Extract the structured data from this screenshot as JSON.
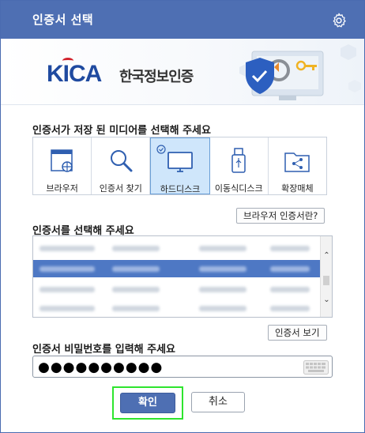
{
  "window": {
    "title": "인증서 선택"
  },
  "banner": {
    "logo_mark": "KICA",
    "logo_text": "한국정보인증"
  },
  "media": {
    "label": "인증서가 저장 된 미디어를 선택해 주세요",
    "selected": "하드디스크",
    "items": [
      {
        "label": "브라우저",
        "icon": "browser-icon"
      },
      {
        "label": "인증서 찾기",
        "icon": "magnifier-icon"
      },
      {
        "label": "하드디스크",
        "icon": "monitor-icon"
      },
      {
        "label": "이동식디스크",
        "icon": "usb-icon"
      },
      {
        "label": "확장매체",
        "icon": "share-folder-icon"
      }
    ],
    "browser_cert_button": "브라우저 인증서란?"
  },
  "certs": {
    "label": "인증서를 선택해 주세요",
    "view_button": "인증서 보기"
  },
  "password": {
    "label": "인증서 비밀번호를 입력해 주세요",
    "masked_value": "●●●●●●●●●●"
  },
  "actions": {
    "ok": "확인",
    "cancel": "취소"
  },
  "colors": {
    "titlebar": "#4e6fb3",
    "selected_media": "#cfe6fb",
    "selected_row": "#4e78c4",
    "highlight": "#2ee52e"
  }
}
